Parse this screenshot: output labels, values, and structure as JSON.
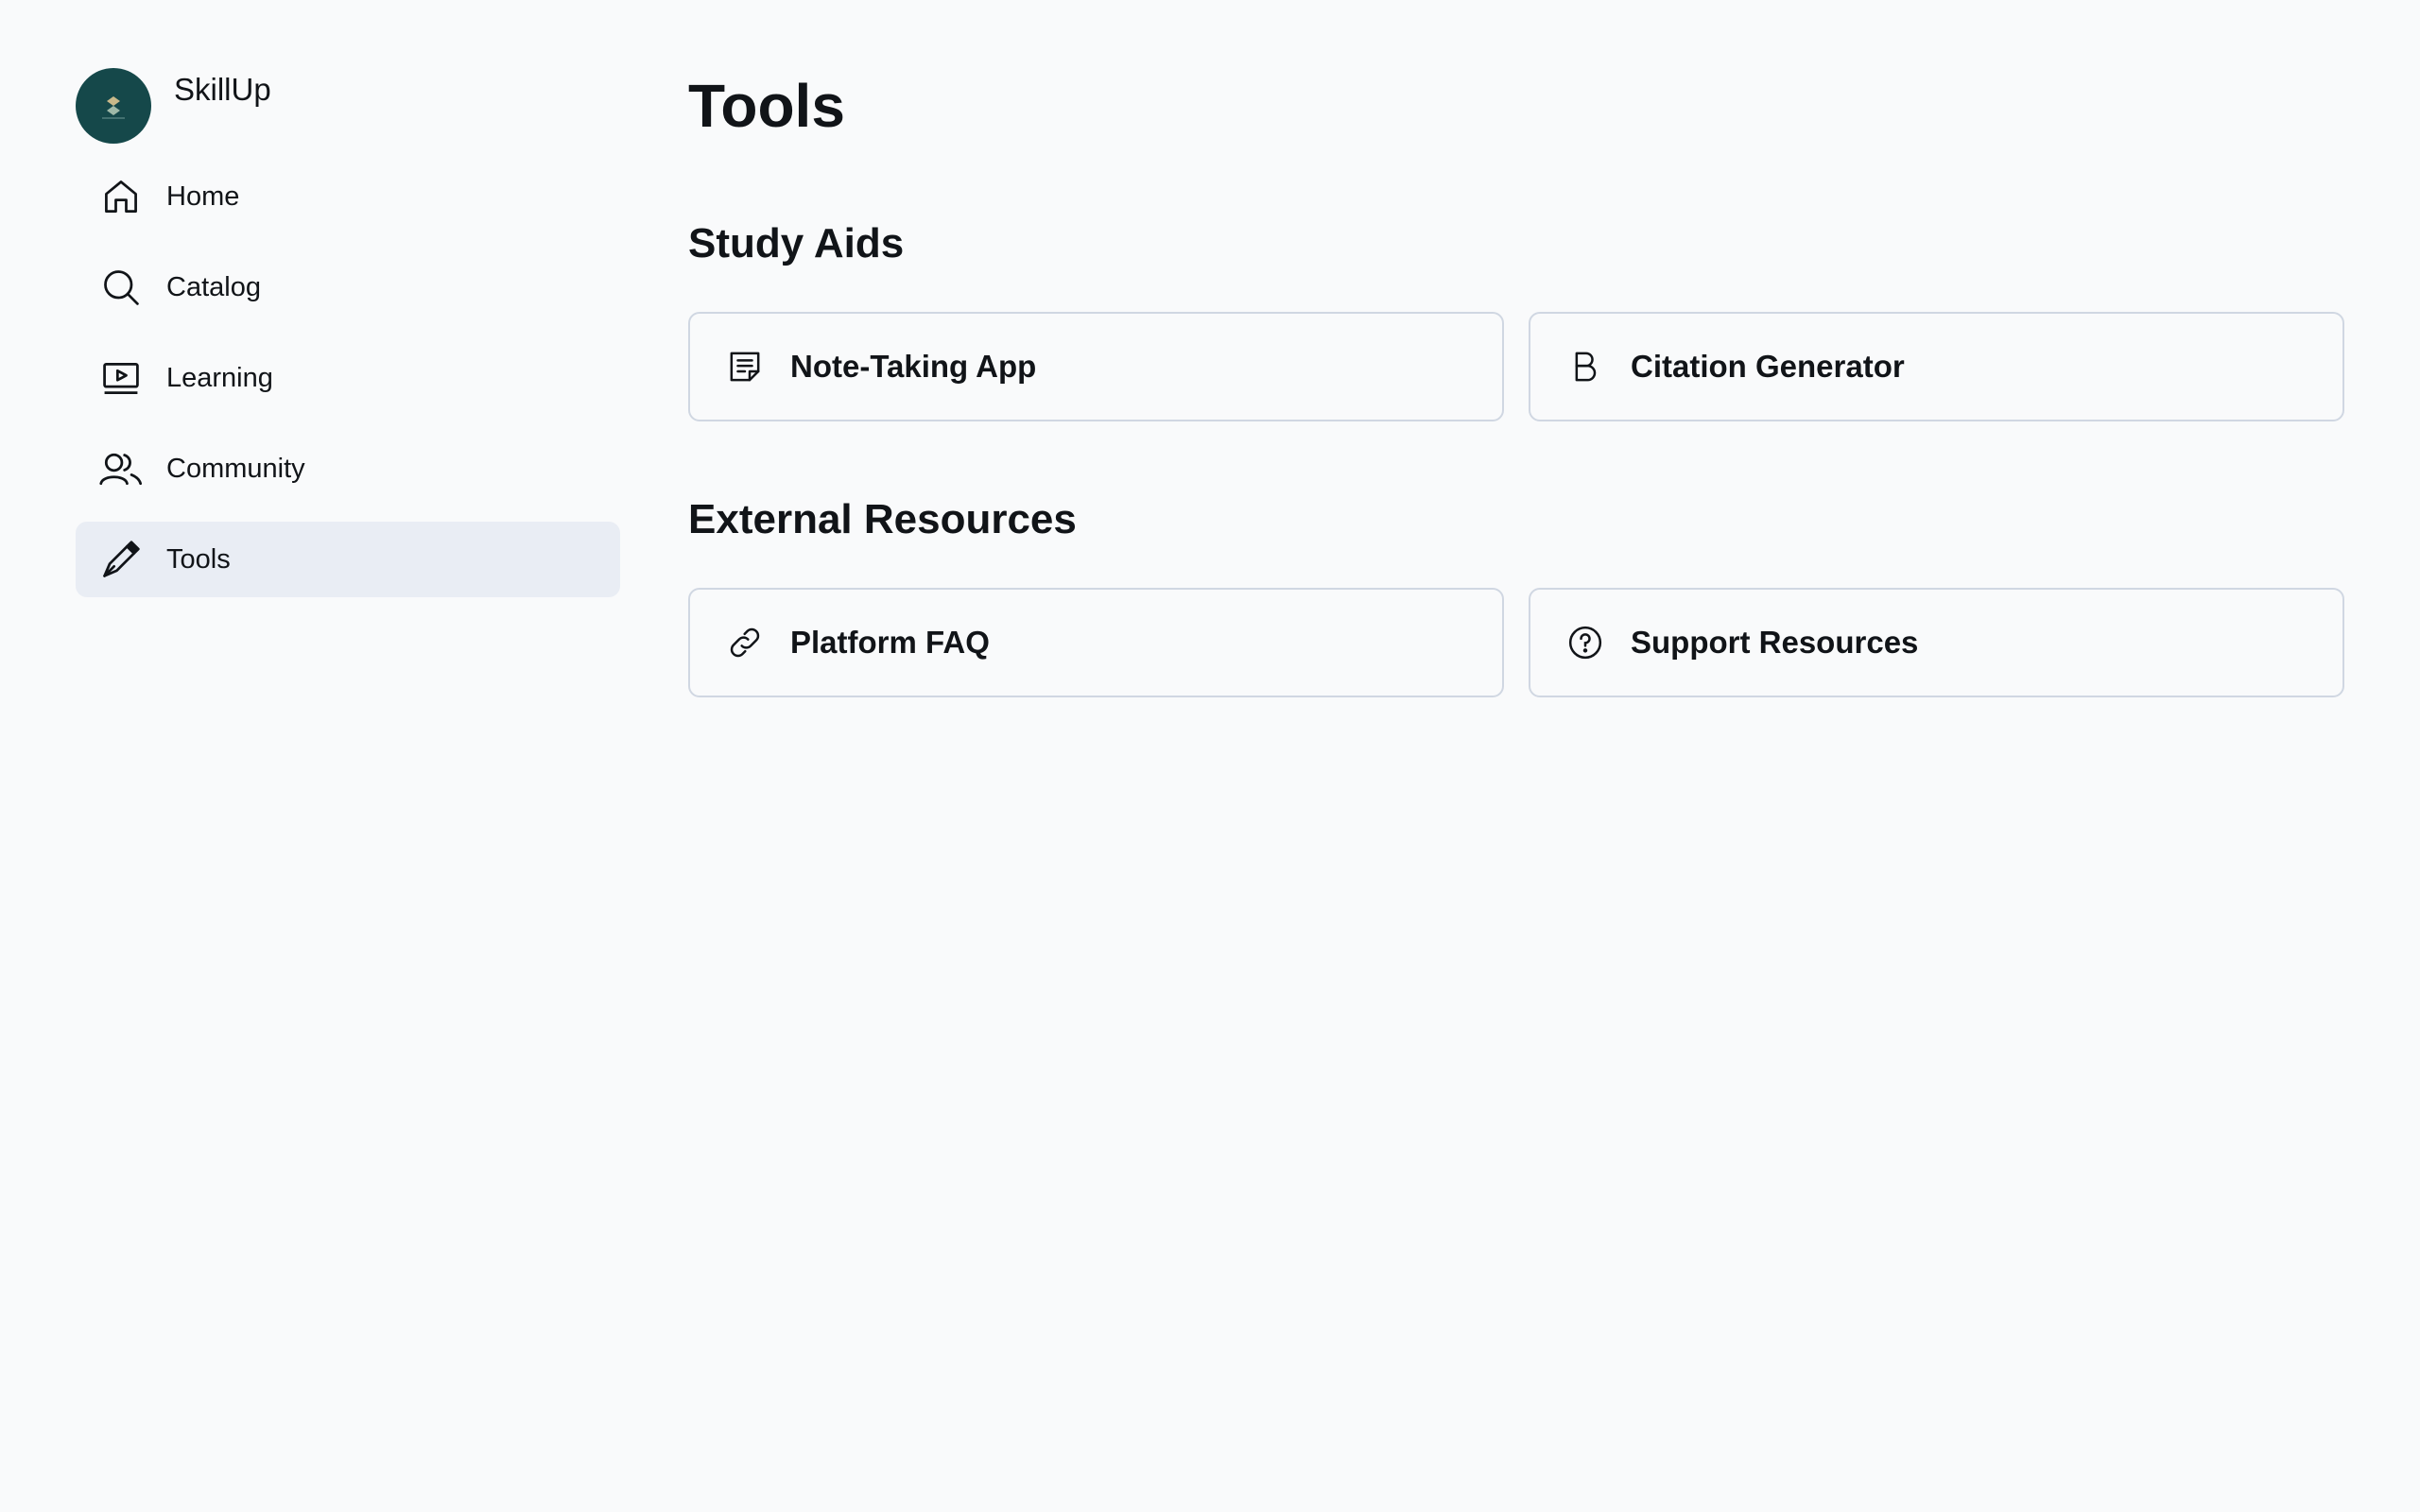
{
  "brand": {
    "name": "SkillUp",
    "logo_color": "#15484a"
  },
  "sidebar": {
    "items": [
      {
        "label": "Home",
        "icon": "home-icon",
        "active": false
      },
      {
        "label": "Catalog",
        "icon": "search-icon",
        "active": false
      },
      {
        "label": "Learning",
        "icon": "play-screen-icon",
        "active": false
      },
      {
        "label": "Community",
        "icon": "users-icon",
        "active": false
      },
      {
        "label": "Tools",
        "icon": "pen-icon",
        "active": true
      }
    ]
  },
  "main": {
    "title": "Tools",
    "sections": [
      {
        "title": "Study Aids",
        "cards": [
          {
            "label": "Note-Taking App",
            "icon": "note-icon"
          },
          {
            "label": "Citation Generator",
            "icon": "bold-b-icon"
          }
        ]
      },
      {
        "title": "External Resources",
        "cards": [
          {
            "label": "Platform FAQ",
            "icon": "link-icon"
          },
          {
            "label": "Support Resources",
            "icon": "question-circle-icon"
          }
        ]
      }
    ]
  },
  "colors": {
    "background": "#f9fafb",
    "active_nav_bg": "#e9edf4",
    "card_border": "#d0d7e2",
    "text": "#111418"
  }
}
